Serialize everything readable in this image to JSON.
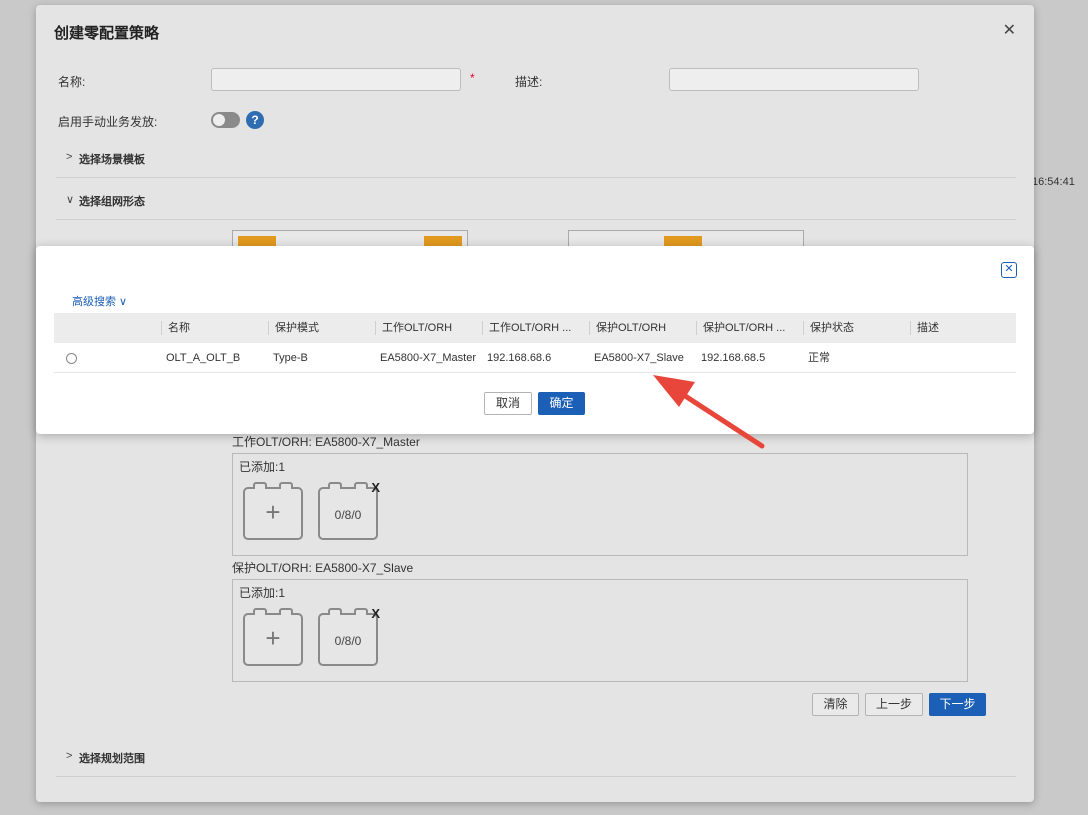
{
  "background": {
    "time": "16:54:41"
  },
  "dialog": {
    "title": "创建零配置策略",
    "close_icon": "close-icon",
    "name_label": "名称:",
    "name_value": "",
    "required_mark": "*",
    "desc_label": "描述:",
    "desc_value": "",
    "manual_label": "启用手动业务发放:",
    "help_text": "?",
    "sections": {
      "scene": "选择场景模板",
      "network": "选择组网形态",
      "range": "选择规划范围"
    },
    "work_olt_title": "工作OLT/ORH: EA5800-X7_Master",
    "protect_olt_title": "保护OLT/ORH: EA5800-X7_Slave",
    "added_work": "已添加:1",
    "added_protect": "已添加:1",
    "slot_add": "+",
    "slot_value": "0/8/0",
    "slot_remove": "X",
    "buttons": {
      "clear": "清除",
      "prev": "上一步",
      "next": "下一步"
    }
  },
  "modal": {
    "advanced_search": "高级搜索 ∨",
    "columns": [
      "名称",
      "保护模式",
      "工作OLT/ORH",
      "工作OLT/ORH ...",
      "保护OLT/ORH",
      "保护OLT/ORH ...",
      "保护状态",
      "描述"
    ],
    "rows": [
      [
        "OLT_A_OLT_B",
        "Type-B",
        "EA5800-X7_Master",
        "192.168.68.6",
        "EA5800-X7_Slave",
        "192.168.68.5",
        "正常",
        ""
      ]
    ],
    "cancel": "取消",
    "confirm": "确定"
  },
  "colors": {
    "primary": "#1b5fb6",
    "annotation_arrow": "#e8463a",
    "topo_icon": "#e29a1e"
  }
}
